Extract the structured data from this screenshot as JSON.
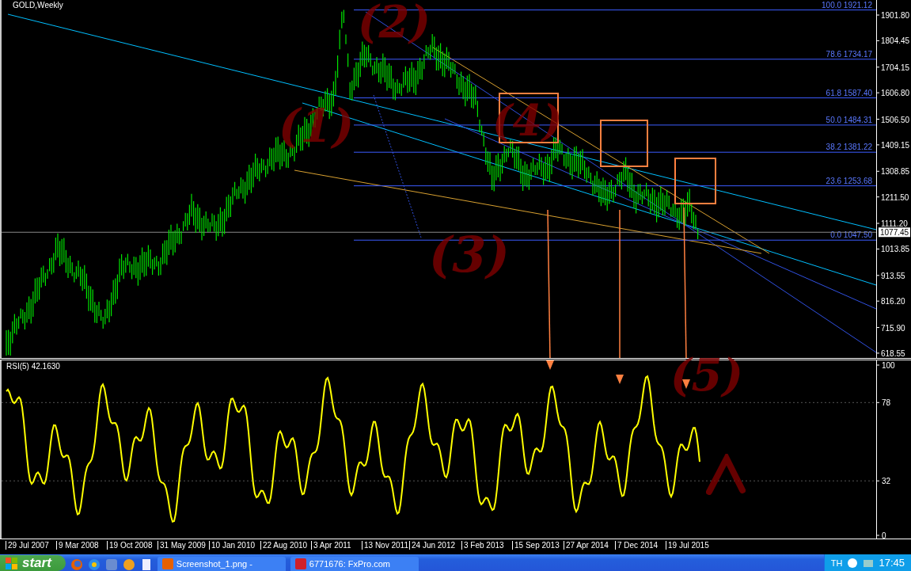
{
  "chart": {
    "title": "GOLD,Weekly",
    "current_price": "1077.45",
    "price_axis": [
      "1901.80",
      "1804.45",
      "1704.15",
      "1606.80",
      "1506.50",
      "1409.15",
      "1308.85",
      "1211.50",
      "1111.20",
      "1013.85",
      "913.55",
      "816.20",
      "715.90",
      "618.55"
    ],
    "fib_levels": [
      {
        "ratio": "100.0",
        "price": "1921.12"
      },
      {
        "ratio": "78.6",
        "price": "1734.17"
      },
      {
        "ratio": "61.8",
        "price": "1587.40"
      },
      {
        "ratio": "50.0",
        "price": "1484.31"
      },
      {
        "ratio": "38.2",
        "price": "1381.22"
      },
      {
        "ratio": "23.6",
        "price": "1253.68"
      },
      {
        "ratio": "0.0",
        "price": "1047.50"
      }
    ],
    "annotations": [
      "(2)",
      "(1)",
      "(4)",
      "(3)",
      "(5)"
    ]
  },
  "rsi": {
    "name": "RSI(5)",
    "value": "42.1630",
    "axis": [
      "100",
      "78",
      "32",
      "0"
    ]
  },
  "time_axis": [
    "29 Jul 2007",
    "9 Mar 2008",
    "19 Oct 2008",
    "31 May 2009",
    "10 Jan 2010",
    "22 Aug 2010",
    "3 Apr 2011",
    "13 Nov 2011",
    "24 Jun 2012",
    "3 Feb 2013",
    "15 Sep 2013",
    "27 Apr 2014",
    "7 Dec 2014",
    "19 Jul 2015"
  ],
  "taskbar": {
    "start": "start",
    "tasks": [
      "Screenshot_1.png -",
      "6771676: FxPro.com"
    ],
    "language": "TH",
    "clock": "17:45"
  }
}
